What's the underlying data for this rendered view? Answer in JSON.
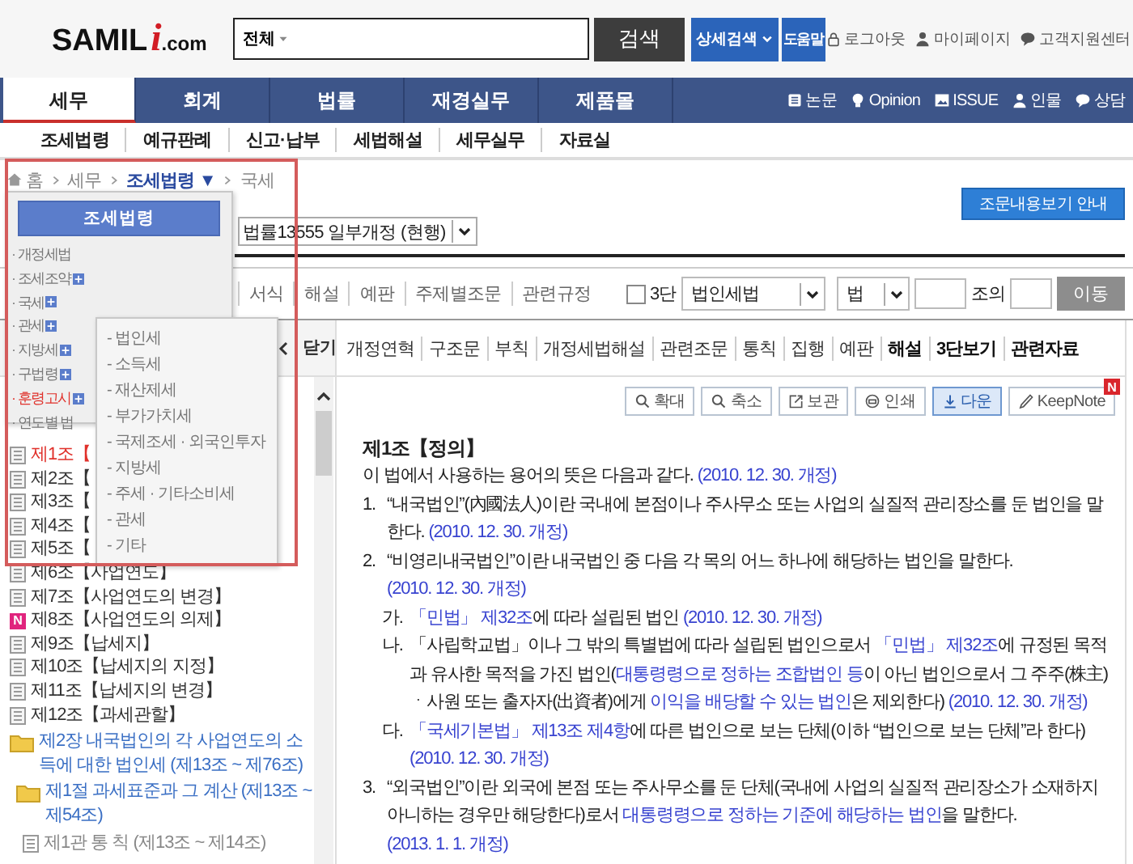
{
  "header": {
    "logo": [
      "SAMIL",
      "i",
      ".com"
    ],
    "search": {
      "scope": "전체",
      "button": "검색"
    },
    "advanced_search": "상세검색",
    "help": "도움말",
    "user_links": [
      "로그아웃",
      "마이페이지",
      "고객지원센터"
    ]
  },
  "main_nav": {
    "tabs": [
      {
        "label": "세무",
        "selected": true
      },
      {
        "label": "회계",
        "selected": false
      },
      {
        "label": "법률",
        "selected": false
      },
      {
        "label": "재경실무",
        "selected": false
      },
      {
        "label": "제품몰",
        "selected": false
      }
    ],
    "links": [
      "논문",
      "Opinion",
      "ISSUE",
      "인물",
      "상담"
    ]
  },
  "sub_nav": [
    "조세법령",
    "예규판례",
    "신고·납부",
    "세법해설",
    "세무실무",
    "자료실"
  ],
  "breadcrumb": [
    {
      "label": "홈",
      "kind": "home"
    },
    {
      "label": "세무",
      "kind": "plain"
    },
    {
      "label": "조세법령",
      "kind": "menu",
      "caret": "▼"
    },
    {
      "label": "국세",
      "kind": "plain"
    }
  ],
  "guide_button": "조문내용보기 안내",
  "law_version": "법률13555 일부개정 (현행)",
  "view_tabs": [
    "서식",
    "해설",
    "예판",
    "주제별조문",
    "관련규정"
  ],
  "jump": {
    "three_column": {
      "label": "3단",
      "checked": false
    },
    "law": "법인세법",
    "level": "법",
    "article_suffix": "조의",
    "button": "이동"
  },
  "panel_toggle": "닫기",
  "article_tabs": [
    {
      "label": "개정연혁",
      "emphasis": false
    },
    {
      "label": "구조문",
      "emphasis": false
    },
    {
      "label": "부칙",
      "emphasis": false
    },
    {
      "label": "개정세법해설",
      "emphasis": false
    },
    {
      "label": "관련조문",
      "emphasis": false
    },
    {
      "label": "통칙",
      "emphasis": false
    },
    {
      "label": "집행",
      "emphasis": false
    },
    {
      "label": "예판",
      "emphasis": false
    },
    {
      "label": "해설",
      "emphasis": true
    },
    {
      "label": "3단보기",
      "emphasis": true
    },
    {
      "label": "관련자료",
      "emphasis": true
    }
  ],
  "tree": [
    {
      "kind": "article",
      "label": "제1조【",
      "selected": true
    },
    {
      "kind": "article",
      "label": "제2조【",
      "selected": false
    },
    {
      "kind": "article",
      "label": "제3조【",
      "selected": false
    },
    {
      "kind": "article",
      "label": "제4조【",
      "selected": false
    },
    {
      "kind": "article",
      "label": "제5조【",
      "selected": false
    },
    {
      "kind": "article",
      "label": "제6조【사업연도】",
      "selected": false
    },
    {
      "kind": "article",
      "label": "제7조【사업연도의 변경】",
      "selected": false
    },
    {
      "kind": "article",
      "label": "제8조【사업연도의 의제】",
      "selected": false,
      "badge": "N"
    },
    {
      "kind": "article",
      "label": "제9조【납세지】",
      "selected": false
    },
    {
      "kind": "article",
      "label": "제10조【납세지의 지정】",
      "selected": false
    },
    {
      "kind": "article",
      "label": "제11조【납세지의 변경】",
      "selected": false
    },
    {
      "kind": "article",
      "label": "제12조【과세관할】",
      "selected": false
    },
    {
      "kind": "folder",
      "label": "제2장 내국법인의 각 사업연도의 소득에 대한 법인세 (제13조 ~ 제76조)",
      "selected": false,
      "children": [
        {
          "kind": "folder",
          "label": "제1절 과세표준과 그 계산 (제13조 ~ 제54조)",
          "selected": false,
          "children": [
            {
              "kind": "section",
              "label": "제1관 통 칙 (제13조 ~ 제14조)",
              "selected": false
            }
          ]
        }
      ]
    }
  ],
  "toolbar": [
    {
      "label": "확대",
      "selected": false
    },
    {
      "label": "축소",
      "selected": false
    },
    {
      "label": "보관",
      "selected": false
    },
    {
      "label": "인쇄",
      "selected": false
    },
    {
      "label": "다운",
      "selected": true
    },
    {
      "label": "KeepNote",
      "selected": false,
      "badge": "N"
    }
  ],
  "article": {
    "title": "제1조【정의】",
    "paragraphs": [
      {
        "kind": "lead",
        "parts": [
          {
            "text": "이 법에서 사용하는 용어의 뜻은 다음과 같다. "
          },
          {
            "text": "(2010. 12. 30. 개정)",
            "link": true
          }
        ]
      },
      {
        "kind": "item",
        "marker": "1.",
        "parts": [
          {
            "text": "“내국법인”(內國法人)이란 국내에 본점이나 주사무소 또는 사업의 실질적 관리장소를 둔 법인을 말한다. "
          },
          {
            "text": "(2010. 12. 30. 개정)",
            "link": true
          }
        ]
      },
      {
        "kind": "item",
        "marker": "2.",
        "parts": [
          {
            "text": "“비영리내국법인”이란 내국법인 중 다음 각 목의 어느 하나에 해당하는 법인을 말한다. "
          },
          {
            "text": "(2010. 12. 30. 개정)",
            "link": true
          }
        ]
      },
      {
        "kind": "sub",
        "marker": "가.",
        "parts": [
          {
            "text": "「민법」 제32조",
            "link": true
          },
          {
            "text": "에 따라 설립된 법인 "
          },
          {
            "text": "(2010. 12. 30. 개정)",
            "link": true
          }
        ]
      },
      {
        "kind": "sub",
        "marker": "나.",
        "parts": [
          {
            "text": "「사립학교법」이나 그 밖의 특별법에 따라 설립된 법인으로서 "
          },
          {
            "text": "「민법」 제32조",
            "link": true
          },
          {
            "text": "에 규정된 목적과 유사한 목적을 가진 법인("
          },
          {
            "text": "대통령령으로 정하는 조합법인 등",
            "link": true
          },
          {
            "text": "이 아닌 법인으로서 그 주주(株主)ㆍ사원 또는 출자자(出資者)에게 "
          },
          {
            "text": "이익을 배당할 수 있는 법인",
            "link": true
          },
          {
            "text": "은 제외한다) "
          },
          {
            "text": "(2010. 12. 30. 개정)",
            "link": true
          }
        ]
      },
      {
        "kind": "sub",
        "marker": "다.",
        "parts": [
          {
            "text": "「국세기본법」 제13조 제4항",
            "link": true
          },
          {
            "text": "에 따른 법인으로 보는 단체(이하 “법인으로 보는 단체”라 한다) "
          },
          {
            "text": "(2010. 12. 30. 개정)",
            "link": true
          }
        ]
      },
      {
        "kind": "item",
        "marker": "3.",
        "parts": [
          {
            "text": "“외국법인”이란 외국에 본점 또는 주사무소를 둔 단체(국내에 사업의 실질적 관리장소가 소재하지 아니하는 경우만 해당한다)로서 "
          },
          {
            "text": "대통령령으로 정하는 기준에 해당하는 법인",
            "link": true
          },
          {
            "text": "을 말한다. "
          },
          {
            "text": "(2013. 1. 1. 개정)",
            "link": true
          }
        ]
      }
    ]
  },
  "menu": {
    "title": "조세법령",
    "items": [
      {
        "label": "· 개정세법",
        "expandable": false,
        "highlighted": false
      },
      {
        "label": "· 조세조약",
        "expandable": true,
        "highlighted": false
      },
      {
        "label": "· 국세",
        "expandable": true,
        "highlighted": false
      },
      {
        "label": "· 관세",
        "expandable": true,
        "highlighted": false
      },
      {
        "label": "· 지방세",
        "expandable": true,
        "highlighted": false
      },
      {
        "label": "· 구법령",
        "expandable": true,
        "highlighted": false
      },
      {
        "label": "· 훈령고시",
        "expandable": true,
        "highlighted": true
      },
      {
        "label": "· 연도별 법",
        "expandable": false,
        "highlighted": false
      }
    ],
    "submenu": [
      "- 법인세",
      "- 소득세",
      "- 재산제세",
      "- 부가가치세",
      "- 국제조세 · 외국인투자",
      "- 지방세",
      "- 주세 · 기타소비세",
      "- 관세",
      "- 기타"
    ]
  }
}
